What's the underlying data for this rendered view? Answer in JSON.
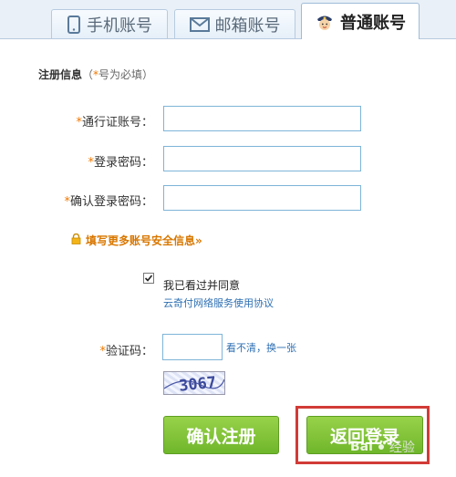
{
  "tabs": [
    {
      "label": "手机账号",
      "icon": "phone-icon",
      "active": false
    },
    {
      "label": "邮箱账号",
      "icon": "mail-icon",
      "active": false
    },
    {
      "label": "普通账号",
      "icon": "user-avatar-icon",
      "active": true
    }
  ],
  "form": {
    "section_title": "注册信息",
    "section_note_open": "（",
    "section_note_star": "*",
    "section_note_text": "号为必填）",
    "required_mark": "*",
    "account_label": "通行证账号：",
    "password_label": "登录密码：",
    "confirm_password_label": "确认登录密码：",
    "account_value": "",
    "password_value": "",
    "confirm_password_value": "",
    "more_info_link": "填写更多账号安全信息»",
    "agree_checked": true,
    "agree_text": "我已看过并同意",
    "agreement_link": "云奇付网络服务使用协议",
    "captcha_label": "验证码：",
    "captcha_value": "",
    "captcha_refresh": "看不清，换一张",
    "captcha_image_text": "3067"
  },
  "buttons": {
    "confirm": "确认注册",
    "back": "返回登录"
  },
  "watermark": {
    "brand": "Bai",
    "suffix": "经验"
  },
  "colors": {
    "accent_green": "#7bc035",
    "required_orange": "#f07800",
    "link_blue": "#2d6fb3",
    "highlight_red": "#d23b36"
  }
}
